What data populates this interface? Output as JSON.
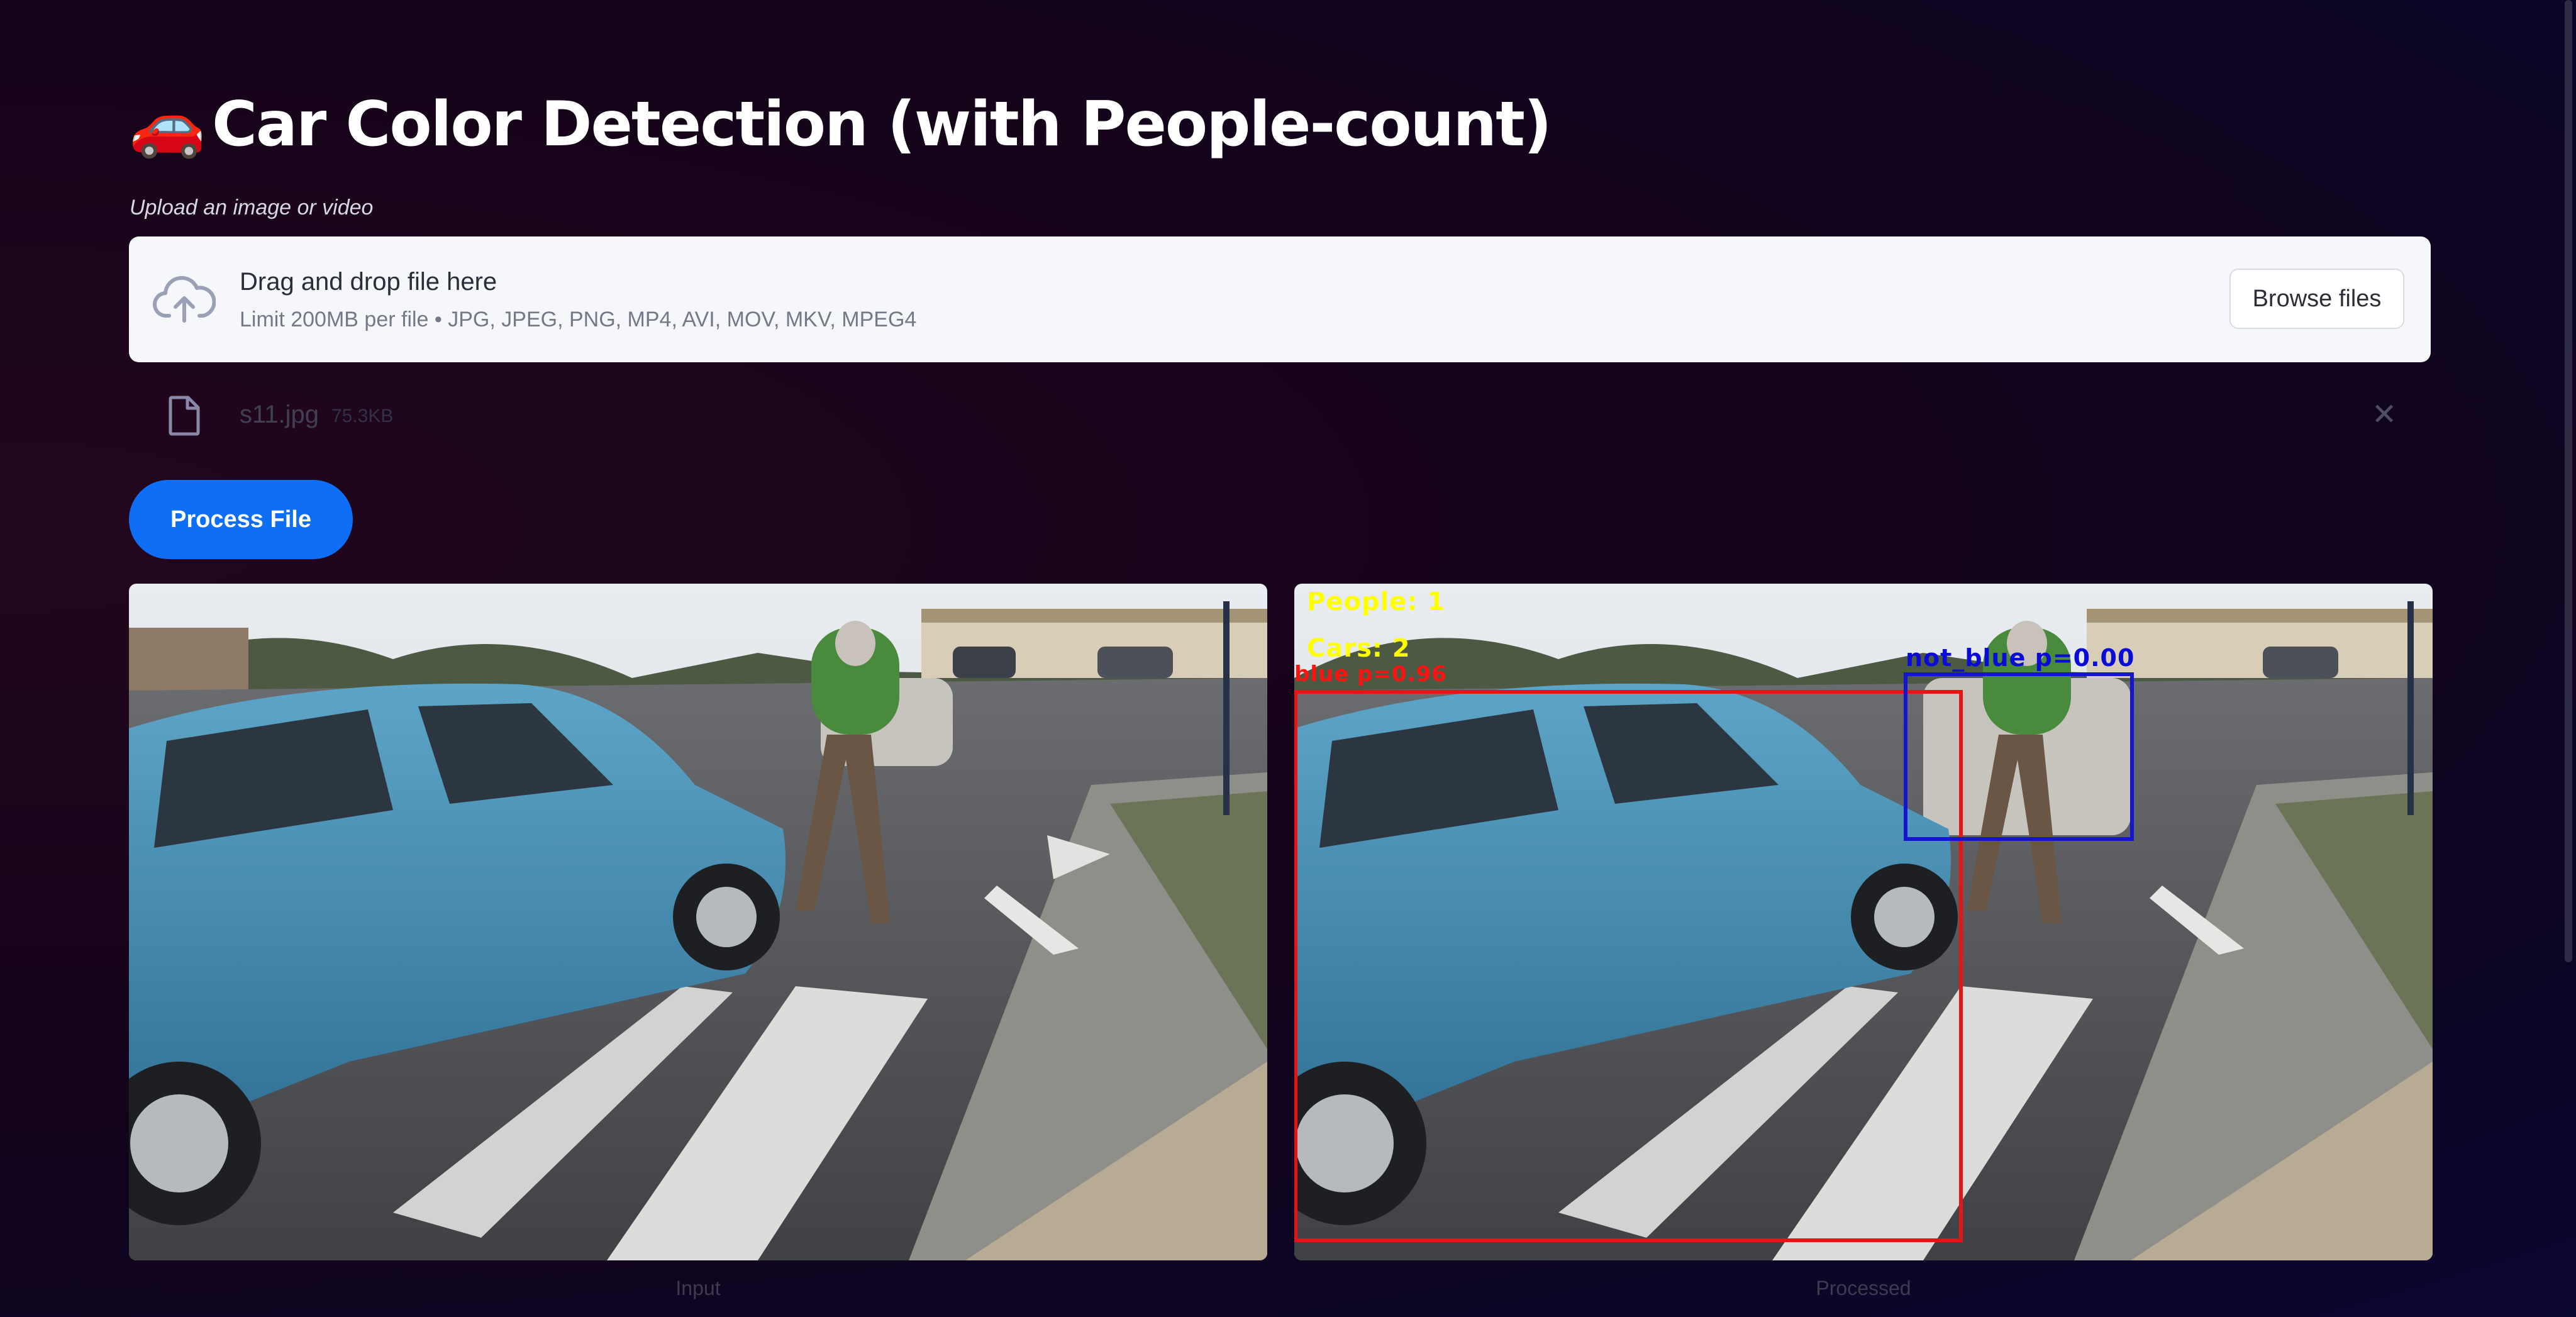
{
  "page": {
    "title_emoji": "🚗",
    "title": "Car Color Detection (with People-count)"
  },
  "upload": {
    "label": "Upload an image or video",
    "dropzone_title": "Drag and drop file here",
    "dropzone_subtitle": "Limit 200MB per file • JPG, JPEG, PNG, MP4, AVI, MOV, MKV, MPEG4",
    "browse_label": "Browse files",
    "file_name": "s11.jpg",
    "file_size": "75.3KB"
  },
  "actions": {
    "process_label": "Process File"
  },
  "results": {
    "input_caption": "Input",
    "processed_caption": "Processed",
    "people_count_label": "People: 1",
    "cars_count_label": "Cars: 2",
    "blue_car_label": "blue p=0.96",
    "other_car_label": "not_blue p=0.00"
  },
  "colors": {
    "primary_button": "#0e6ff6",
    "blue_box": "#1414d2",
    "red_box": "#e61414",
    "overlay_text": "#ffff00"
  },
  "icons": {
    "upload": "cloud-upload-icon",
    "file": "file-icon",
    "close": "close-icon"
  }
}
